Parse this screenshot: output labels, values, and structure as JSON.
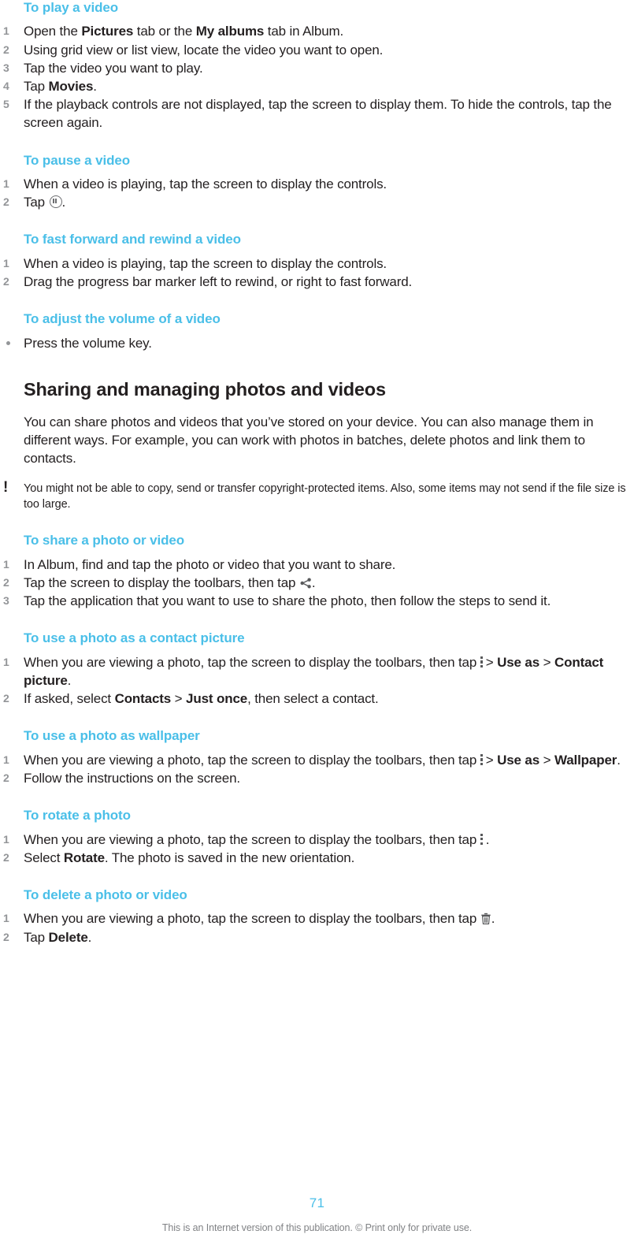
{
  "document": {
    "page_number": "71",
    "footer": "This is an Internet version of this publication. © Print only for private use.",
    "accent_color": "#4ABFE8",
    "text_color": "#231f20",
    "number_color": "#939598"
  },
  "sections": [
    {
      "id": "play-video",
      "heading": "To play a video",
      "steps": [
        {
          "num": "1",
          "parts": [
            {
              "t": "Open the ",
              "b": false
            },
            {
              "t": "Pictures",
              "b": true
            },
            {
              "t": " tab or the ",
              "b": false
            },
            {
              "t": "My albums",
              "b": true
            },
            {
              "t": " tab in Album.",
              "b": false
            }
          ]
        },
        {
          "num": "2",
          "parts": [
            {
              "t": "Using grid view or list view, locate the video you want to open.",
              "b": false
            }
          ]
        },
        {
          "num": "3",
          "parts": [
            {
              "t": "Tap the video you want to play.",
              "b": false
            }
          ]
        },
        {
          "num": "4",
          "parts": [
            {
              "t": "Tap ",
              "b": false
            },
            {
              "t": "Movies",
              "b": true
            },
            {
              "t": ".",
              "b": false
            }
          ]
        },
        {
          "num": "5",
          "parts": [
            {
              "t": "If the playback controls are not displayed, tap the screen to display them. To hide the controls, tap the screen again.",
              "b": false
            }
          ]
        }
      ]
    },
    {
      "id": "pause-video",
      "heading": "To pause a video",
      "steps": [
        {
          "num": "1",
          "parts": [
            {
              "t": "When a video is playing, tap the screen to display the controls.",
              "b": false
            }
          ]
        },
        {
          "num": "2",
          "parts": [
            {
              "t": "Tap ",
              "b": false
            },
            {
              "icon": "pause-icon"
            },
            {
              "t": ".",
              "b": false
            }
          ]
        }
      ]
    },
    {
      "id": "fast-forward-rewind",
      "heading": "To fast forward and rewind a video",
      "steps": [
        {
          "num": "1",
          "parts": [
            {
              "t": "When a video is playing, tap the screen to display the controls.",
              "b": false
            }
          ]
        },
        {
          "num": "2",
          "parts": [
            {
              "t": "Drag the progress bar marker left to rewind, or right to fast forward.",
              "b": false
            }
          ]
        }
      ]
    },
    {
      "id": "adjust-volume",
      "heading": "To adjust the volume of a video",
      "bullets": [
        {
          "parts": [
            {
              "t": "Press the volume key.",
              "b": false
            }
          ]
        }
      ]
    },
    {
      "id": "sharing-managing",
      "section_heading": "Sharing and managing photos and videos",
      "intro": "You can share photos and videos that you’ve stored on your device. You can also manage them in different ways. For example, you can work with photos in batches, delete photos and link them to contacts.",
      "note": "You might not be able to copy, send or transfer copyright-protected items. Also, some items may not send if the file size is too large."
    },
    {
      "id": "share-photo-video",
      "heading": "To share a photo or video",
      "steps": [
        {
          "num": "1",
          "parts": [
            {
              "t": "In Album, find and tap the photo or video that you want to share.",
              "b": false
            }
          ]
        },
        {
          "num": "2",
          "parts": [
            {
              "t": "Tap the screen to display the toolbars, then tap ",
              "b": false
            },
            {
              "icon": "share-icon"
            },
            {
              "t": ".",
              "b": false
            }
          ]
        },
        {
          "num": "3",
          "parts": [
            {
              "t": "Tap the application that you want to use to share the photo, then follow the steps to send it.",
              "b": false
            }
          ]
        }
      ]
    },
    {
      "id": "contact-picture",
      "heading": "To use a photo as a contact picture",
      "steps": [
        {
          "num": "1",
          "parts": [
            {
              "t": "When you are viewing a photo, tap the screen to display the toolbars, then tap ",
              "b": false
            },
            {
              "icon": "overflow-menu-icon"
            },
            {
              "t": "> ",
              "b": false
            },
            {
              "t": "Use as",
              "b": true
            },
            {
              "t": " > ",
              "b": false
            },
            {
              "t": "Contact picture",
              "b": true
            },
            {
              "t": ".",
              "b": false
            }
          ]
        },
        {
          "num": "2",
          "parts": [
            {
              "t": "If asked, select ",
              "b": false
            },
            {
              "t": "Contacts",
              "b": true
            },
            {
              "t": " > ",
              "b": false
            },
            {
              "t": "Just once",
              "b": true
            },
            {
              "t": ", then select a contact.",
              "b": false
            }
          ]
        }
      ]
    },
    {
      "id": "wallpaper",
      "heading": "To use a photo as wallpaper",
      "steps": [
        {
          "num": "1",
          "parts": [
            {
              "t": "When you are viewing a photo, tap the screen to display the toolbars, then tap ",
              "b": false
            },
            {
              "icon": "overflow-menu-icon"
            },
            {
              "t": "> ",
              "b": false
            },
            {
              "t": "Use as",
              "b": true
            },
            {
              "t": " > ",
              "b": false
            },
            {
              "t": "Wallpaper",
              "b": true
            },
            {
              "t": ".",
              "b": false
            }
          ]
        },
        {
          "num": "2",
          "parts": [
            {
              "t": "Follow the instructions on the screen.",
              "b": false
            }
          ]
        }
      ]
    },
    {
      "id": "rotate-photo",
      "heading": "To rotate a photo",
      "steps": [
        {
          "num": "1",
          "parts": [
            {
              "t": "When you are viewing a photo, tap the screen to display the toolbars, then tap ",
              "b": false
            },
            {
              "icon": "overflow-menu-icon"
            },
            {
              "t": ".",
              "b": false
            }
          ]
        },
        {
          "num": "2",
          "parts": [
            {
              "t": "Select ",
              "b": false
            },
            {
              "t": "Rotate",
              "b": true
            },
            {
              "t": ". The photo is saved in the new orientation.",
              "b": false
            }
          ]
        }
      ]
    },
    {
      "id": "delete-photo-video",
      "heading": "To delete a photo or video",
      "steps": [
        {
          "num": "1",
          "parts": [
            {
              "t": "When you are viewing a photo, tap the screen to display the toolbars, then tap ",
              "b": false
            },
            {
              "icon": "trash-icon"
            },
            {
              "t": ".",
              "b": false
            }
          ]
        },
        {
          "num": "2",
          "parts": [
            {
              "t": "Tap ",
              "b": false
            },
            {
              "t": "Delete",
              "b": true
            },
            {
              "t": ".",
              "b": false
            }
          ]
        }
      ]
    }
  ]
}
